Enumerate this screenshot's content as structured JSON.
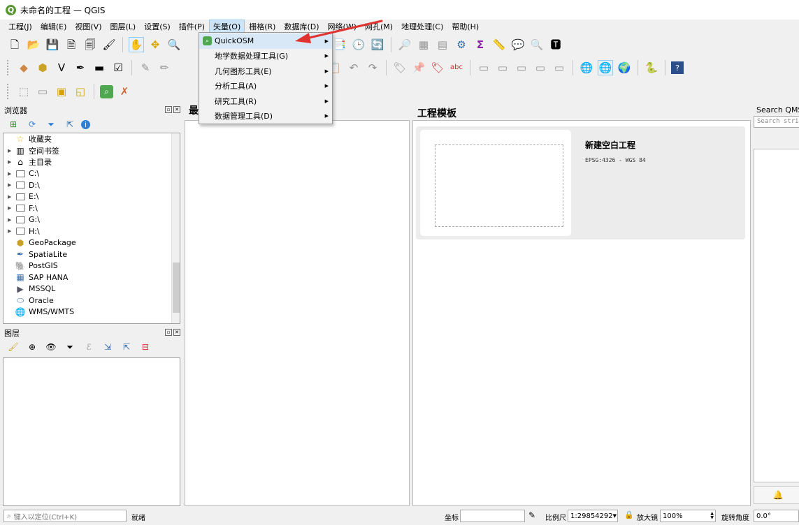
{
  "window": {
    "title": "未命名的工程 — QGIS",
    "logo_letter": "Q"
  },
  "menubar": {
    "items": [
      {
        "label": "工程(J)"
      },
      {
        "label": "编辑(E)"
      },
      {
        "label": "视图(V)"
      },
      {
        "label": "图层(L)"
      },
      {
        "label": "设置(S)"
      },
      {
        "label": "插件(P)"
      },
      {
        "label": "矢量(O)",
        "active": true
      },
      {
        "label": "栅格(R)"
      },
      {
        "label": "数据库(D)"
      },
      {
        "label": "网络(W)"
      },
      {
        "label": "网孔(M)"
      },
      {
        "label": "地理处理(C)"
      },
      {
        "label": "帮助(H)"
      }
    ]
  },
  "vector_menu": {
    "items": [
      {
        "label": "QuickOSM",
        "icon": "quickosm-icon"
      },
      {
        "label": "地学数据处理工具(G)"
      },
      {
        "label": "几何图形工具(E)"
      },
      {
        "label": "分析工具(A)"
      },
      {
        "label": "研究工具(R)"
      },
      {
        "label": "数据管理工具(D)"
      }
    ]
  },
  "browser": {
    "title": "浏览器",
    "items": [
      {
        "label": "收藏夹",
        "icon": "star-icon",
        "expandable": false
      },
      {
        "label": "空间书签",
        "icon": "bookmark-icon",
        "expandable": true
      },
      {
        "label": "主目录",
        "icon": "home-icon",
        "expandable": true
      },
      {
        "label": "C:\\",
        "icon": "folder-icon",
        "expandable": true
      },
      {
        "label": "D:\\",
        "icon": "folder-icon",
        "expandable": true
      },
      {
        "label": "E:\\",
        "icon": "folder-icon",
        "expandable": true
      },
      {
        "label": "F:\\",
        "icon": "folder-icon",
        "expandable": true
      },
      {
        "label": "G:\\",
        "icon": "folder-icon",
        "expandable": true
      },
      {
        "label": "H:\\",
        "icon": "folder-icon",
        "expandable": true
      },
      {
        "label": "GeoPackage",
        "icon": "geopackage-icon",
        "expandable": false
      },
      {
        "label": "SpatiaLite",
        "icon": "spatialite-icon",
        "expandable": false
      },
      {
        "label": "PostGIS",
        "icon": "postgis-icon",
        "expandable": false
      },
      {
        "label": "SAP HANA",
        "icon": "saphana-icon",
        "expandable": false
      },
      {
        "label": "MSSQL",
        "icon": "mssql-icon",
        "expandable": false
      },
      {
        "label": "Oracle",
        "icon": "oracle-icon",
        "expandable": false
      },
      {
        "label": "WMS/WMTS",
        "icon": "wms-icon",
        "expandable": false
      }
    ]
  },
  "layers": {
    "title": "图层"
  },
  "recent": {
    "title": "最"
  },
  "templates": {
    "title": "工程模板",
    "card": {
      "name": "新建空白工程",
      "crs": "EPSG:4326 - WGS 84"
    }
  },
  "qms": {
    "title": "Search QMS",
    "placeholder": "Search string"
  },
  "statusbar": {
    "locator_placeholder": "键入以定位(Ctrl+K)",
    "ready": "就绪",
    "coord_label": "坐标",
    "coord_value": "",
    "scale_label": "比例尺",
    "scale_value": "1:29854292",
    "magnifier_label": "放大镜",
    "magnifier_value": "100%",
    "rotation_label": "旋转角度",
    "rotation_value": "0.0°"
  },
  "colors": {
    "accent": "#0078d7",
    "menu_highlight": "#cce4f7",
    "arrow": "#e0322e"
  }
}
